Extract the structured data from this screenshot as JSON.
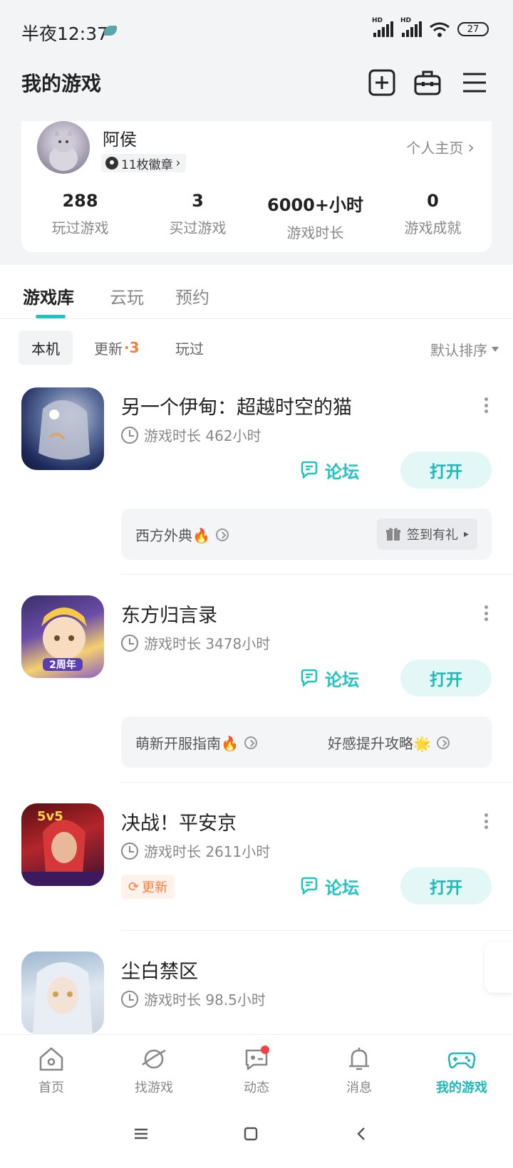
{
  "status_bar": {
    "time": "半夜12:37",
    "battery": "27"
  },
  "header": {
    "title": "我的游戏"
  },
  "profile": {
    "name": "阿侯",
    "badges": "11枚徽章",
    "homepage_link": "个人主页",
    "stats": [
      {
        "value": "288",
        "label": "玩过游戏"
      },
      {
        "value": "3",
        "label": "买过游戏"
      },
      {
        "value": "6000+小时",
        "label": "游戏时长"
      },
      {
        "value": "0",
        "label": "游戏成就"
      }
    ]
  },
  "tabs": [
    "游戏库",
    "云玩",
    "预约"
  ],
  "filters": {
    "local": "本机",
    "update": "更新",
    "update_count": "·3",
    "played": "玩过",
    "sort": "默认排序"
  },
  "games": [
    {
      "title": "另一个伊甸：超越时空的猫",
      "playtime": "游戏时长 462小时",
      "forum": "论坛",
      "open": "打开",
      "links": [
        "西方外典🔥"
      ],
      "gift": "签到有礼"
    },
    {
      "title": "东方归言录",
      "playtime": "游戏时长 3478小时",
      "forum": "论坛",
      "open": "打开",
      "links": [
        "萌新开服指南🔥",
        "好感提升攻略🌟"
      ],
      "icon_text": "2周年"
    },
    {
      "title": "决战！平安京",
      "playtime": "游戏时长 2611小时",
      "forum": "论坛",
      "open": "打开",
      "update_tag": "更新",
      "icon_text": "5v5"
    },
    {
      "title": "尘白禁区",
      "playtime": "游戏时长 98.5小时"
    }
  ],
  "bottom_nav": [
    {
      "label": "首页",
      "icon": "home-icon"
    },
    {
      "label": "找游戏",
      "icon": "planet-icon"
    },
    {
      "label": "动态",
      "icon": "chat-icon"
    },
    {
      "label": "消息",
      "icon": "bell-icon"
    },
    {
      "label": "我的游戏",
      "icon": "gamepad-icon"
    }
  ],
  "colors": {
    "accent": "#22c2c2",
    "orange": "#ff7a3c",
    "background": "#f3f4f6"
  }
}
